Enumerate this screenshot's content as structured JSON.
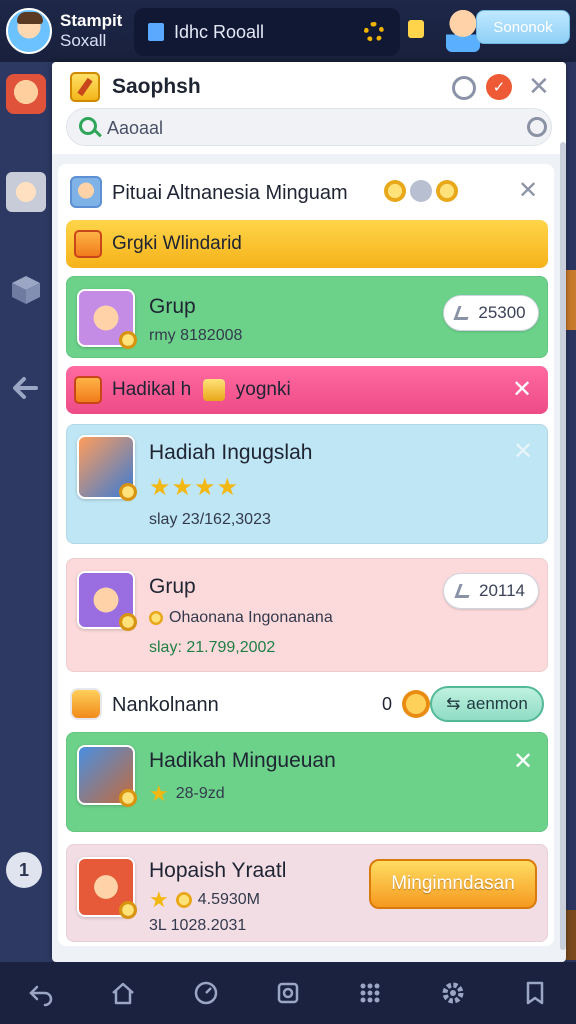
{
  "topbar": {
    "user_name": "Stampit",
    "user_sub": "Soxall",
    "tab_label": "Idhc Rooall",
    "button_label": "Sononok"
  },
  "panel": {
    "title": "Saophsh",
    "search_placeholder": "Aaoaal"
  },
  "list_header": {
    "title": "Pituai Altnanesia Minguam"
  },
  "banner_yellow": {
    "label": "Grgki Wlindarid"
  },
  "card_grup_1": {
    "title": "Grup",
    "subtitle": "rmy 8182008",
    "button": "25300"
  },
  "banner_pink": {
    "label_a": "Hadikal h",
    "label_b": "yognki"
  },
  "card_hadiah": {
    "title": "Hadiah Ingugslah",
    "stars": "★★★★",
    "date": "slay 23/162,3023"
  },
  "card_grup_2": {
    "title": "Grup",
    "subtitle": "Ohaonana Ingonanana",
    "date": "slay: 21.799,2002",
    "button": "20114"
  },
  "plain_row": {
    "title": "Nankolnann",
    "count": "0",
    "button": "aenmon"
  },
  "card_minguean": {
    "title": "Hadikah Mingueuan",
    "stars": "★",
    "value": "28-9zd"
  },
  "card_hopaish": {
    "title": "Hopaish Yraatl",
    "stars": "★",
    "value": "4.5930M",
    "date": "3L 1028.2031",
    "button": "Mingimndasan"
  },
  "rail": {
    "badge": "1"
  },
  "colors": {
    "banner_yellow": "#f6b21a",
    "banner_pink": "#ee4b87",
    "card_green": "#6cd28a",
    "card_blue": "#bfe6f4",
    "card_pink": "#fcdadb",
    "orange_button": "#f59a1f"
  }
}
